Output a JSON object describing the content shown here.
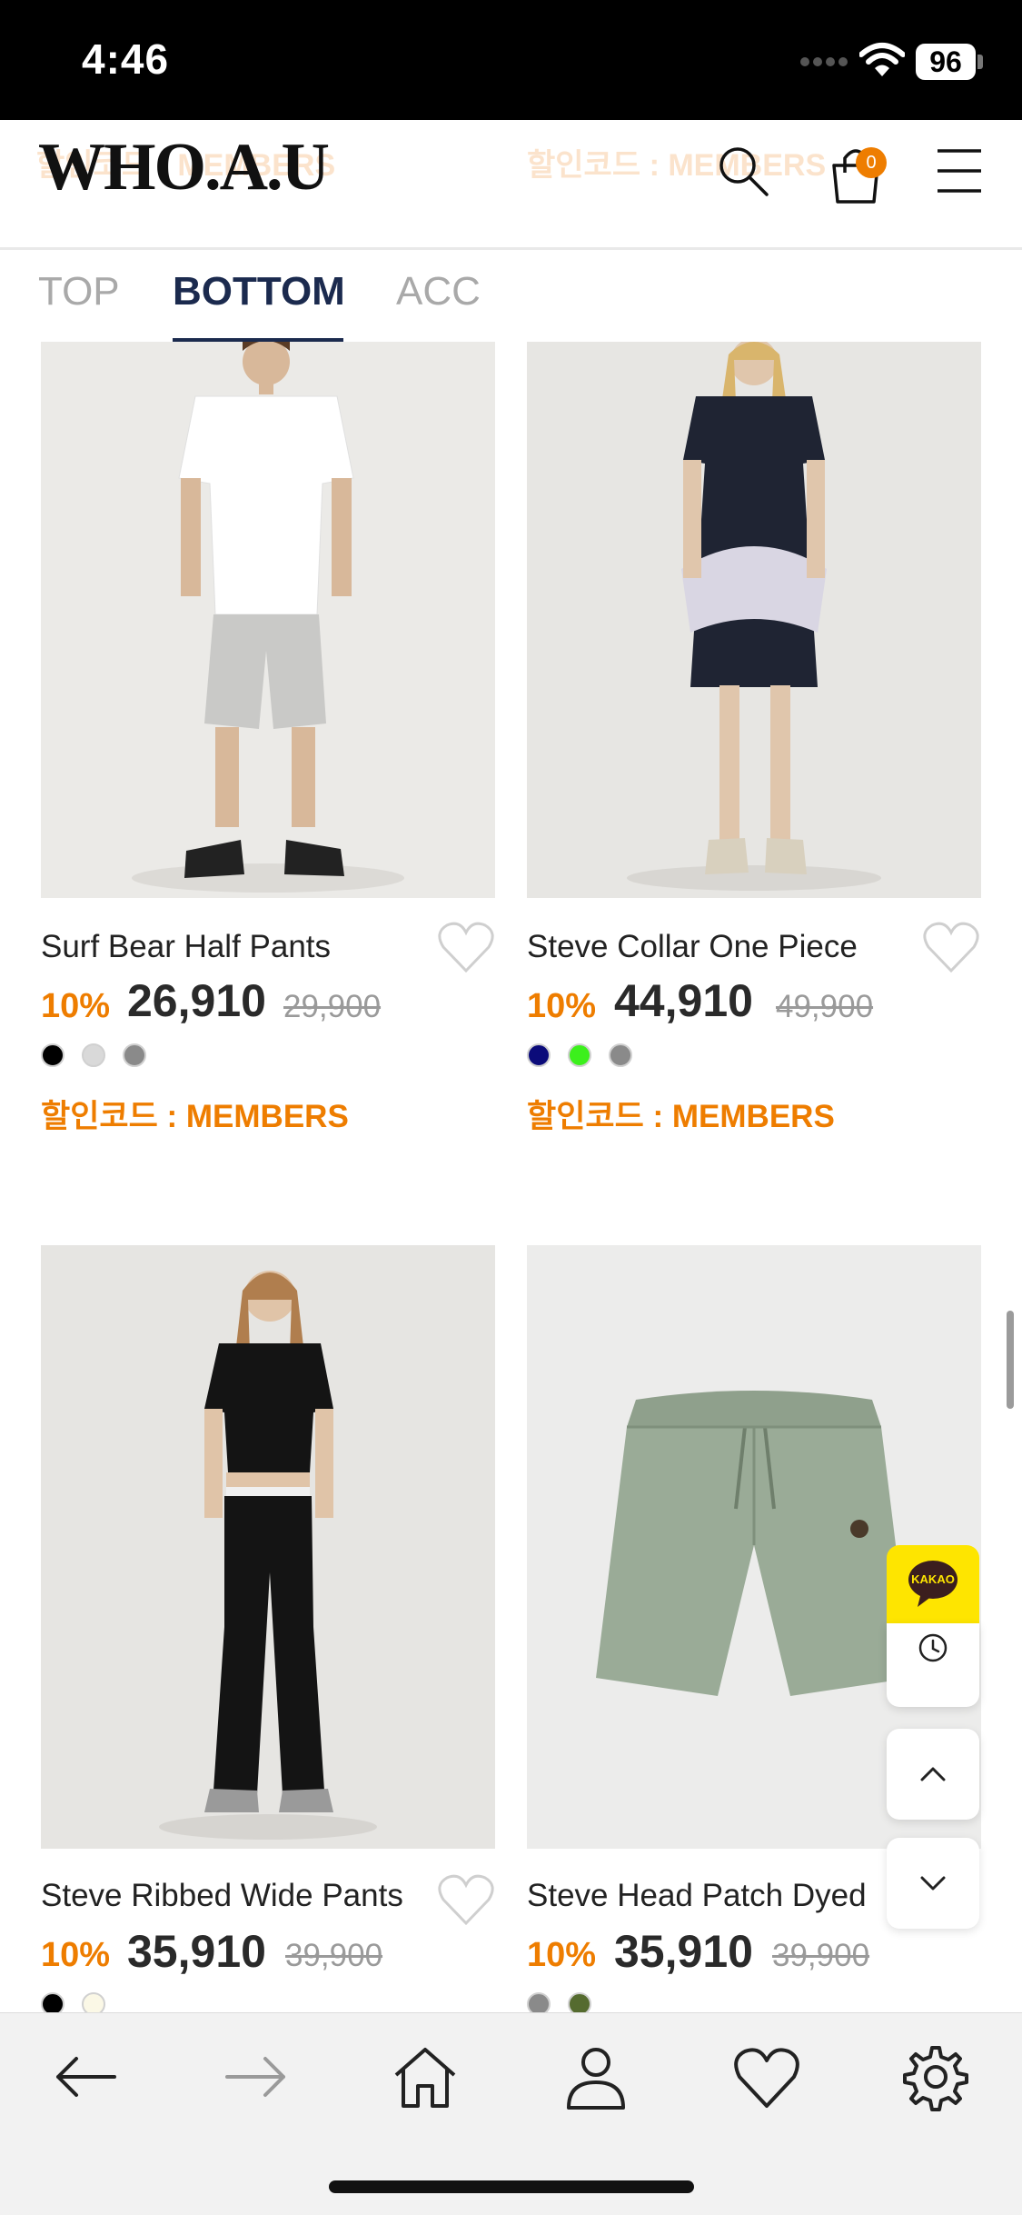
{
  "status_bar": {
    "time": "4:46",
    "battery": "96"
  },
  "header": {
    "logo": "WHO.A.U",
    "ghost_left": "할인코드 : MEMBERS",
    "ghost_right": "할인코드 : MEMBERS",
    "cart_count": "0"
  },
  "tabs": [
    {
      "label": "TOP",
      "active": false
    },
    {
      "label": "BOTTOM",
      "active": true
    },
    {
      "label": "ACC",
      "active": false
    }
  ],
  "products": [
    {
      "name": "Surf Bear Half Pants",
      "discount": "10%",
      "price": "26,910",
      "original": "29,900",
      "colors": [
        "#000000",
        "#d9d9d9",
        "#8a8a8a"
      ],
      "promo": "할인코드 : MEMBERS"
    },
    {
      "name": "Steve Collar One Piece",
      "discount": "10%",
      "price": "44,910",
      "original": "49,900",
      "colors": [
        "#0b0b7a",
        "#3cf01c",
        "#8a8a8a"
      ],
      "promo": "할인코드 : MEMBERS"
    },
    {
      "name": "Steve Ribbed Wide Pants",
      "discount": "10%",
      "price": "35,910",
      "original": "39,900",
      "colors": [
        "#000000",
        "#fbf8e6"
      ]
    },
    {
      "name": "Steve Head Patch Dyed",
      "discount": "10%",
      "price": "35,910",
      "original": "39,900",
      "colors": [
        "#8a8a8a",
        "#556b2f"
      ]
    }
  ],
  "side": {
    "kakao_label": "KAKAO"
  },
  "colors": {
    "accent": "#ee7d00",
    "navy": "#1b2a4e"
  }
}
